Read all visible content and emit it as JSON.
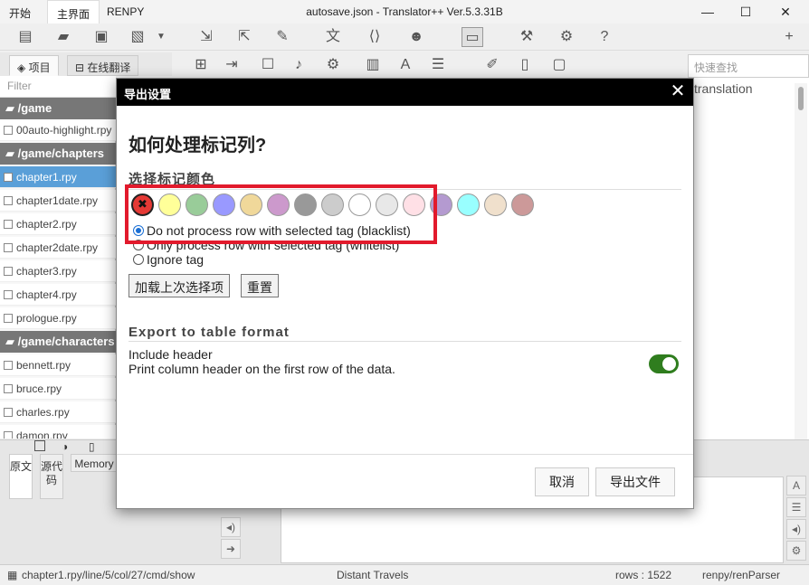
{
  "titlebar": {
    "menus": [
      "开始",
      "主界面",
      "RENPY"
    ],
    "title": "autosave.json - Translator++ Ver.5.3.31B",
    "min": "—",
    "max": "☐",
    "close": "✕"
  },
  "sidebar": {
    "tabs": [
      "项目",
      "在线翻译"
    ],
    "filter_placeholder": "Filter",
    "folders": [
      "/game",
      "/game/chapters",
      "/game/characters"
    ],
    "files_game": [
      "00auto-highlight.rpy"
    ],
    "files_chapters": [
      "chapter1.rpy",
      "chapter1date.rpy",
      "chapter2.rpy",
      "chapter2date.rpy",
      "chapter3.rpy",
      "chapter4.rpy",
      "prologue.rpy"
    ],
    "files_characters": [
      "bennett.rpy",
      "bruce.rpy",
      "charles.rpy",
      "damon.rpy"
    ]
  },
  "search": {
    "placeholder": "快速查找"
  },
  "grid": {
    "column_header": "translation"
  },
  "bottom_tabs": [
    "原文",
    "源代码",
    "Memory"
  ],
  "statusbar": {
    "path": "chapter1.rpy/line/5/col/27/cmd/show",
    "context": "Distant Travels",
    "rows": "rows : 1522",
    "parser": "renpy/renParser"
  },
  "dialog": {
    "title": "导出设置",
    "heading": "如何处理标记列?",
    "color_section": "选择标记颜色",
    "colors": [
      "#e53935",
      "#ffff99",
      "#99cc99",
      "#9999ff",
      "#f0d89a",
      "#cc99cc",
      "#999999",
      "#cccccc",
      "#ffffff",
      "#e8e8e8",
      "#ffe0e6",
      "#b49ad0",
      "#99ffff",
      "#f0e0cc",
      "#cc9999"
    ],
    "selected_color_index": 0,
    "radio_options": [
      "Do not process row with selected tag (blacklist)",
      "Only process row with selected tag (whitelist)",
      "Ignore tag"
    ],
    "radio_selected": 0,
    "load_last_button": "加载上次选择项",
    "reset_button": "重置",
    "export_section": "Export to table format",
    "include_header_label": "Include header",
    "include_header_desc": "Print column header on the first row of the data.",
    "include_header_enabled": true,
    "cancel_button": "取消",
    "export_button": "导出文件",
    "highlight_color": "#e21a2c",
    "toggle_color": "#2f7d1e"
  }
}
